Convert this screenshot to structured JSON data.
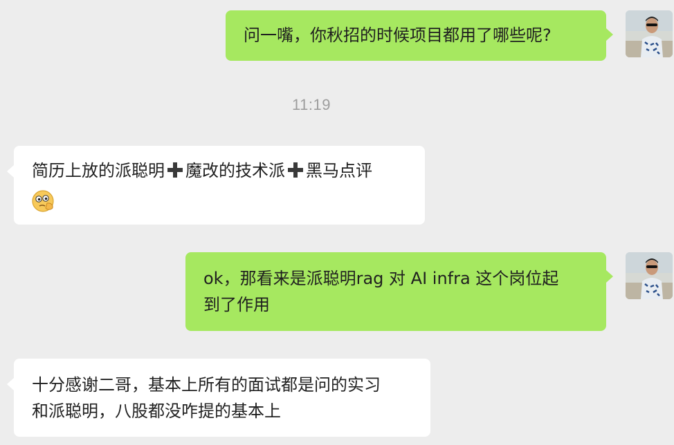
{
  "messages": {
    "m1": {
      "text": "问一嘴，你秋招的时候项目都用了哪些呢?"
    },
    "timestamp": "11:19",
    "m2": {
      "part1": "简历上放的派聪明",
      "part2": "魔改的技术派",
      "part3": "黑马点评",
      "emoji": "thinking-face-emoji"
    },
    "m3": {
      "line1": "ok，那看来是派聪明rag 对 AI infra 这个岗位起",
      "line2": "到了作用"
    },
    "m4": {
      "line1": "十分感谢二哥，基本上所有的面试都是问的实习",
      "line2": "和派聪明，八股都没咋提的基本上"
    }
  },
  "colors": {
    "background": "#ededed",
    "outgoing_bubble": "#a6e860",
    "incoming_bubble": "#ffffff",
    "timestamp_text": "#9d9d9d"
  },
  "icons": {
    "plus": "heavy-plus-icon",
    "avatar": "user-avatar"
  }
}
